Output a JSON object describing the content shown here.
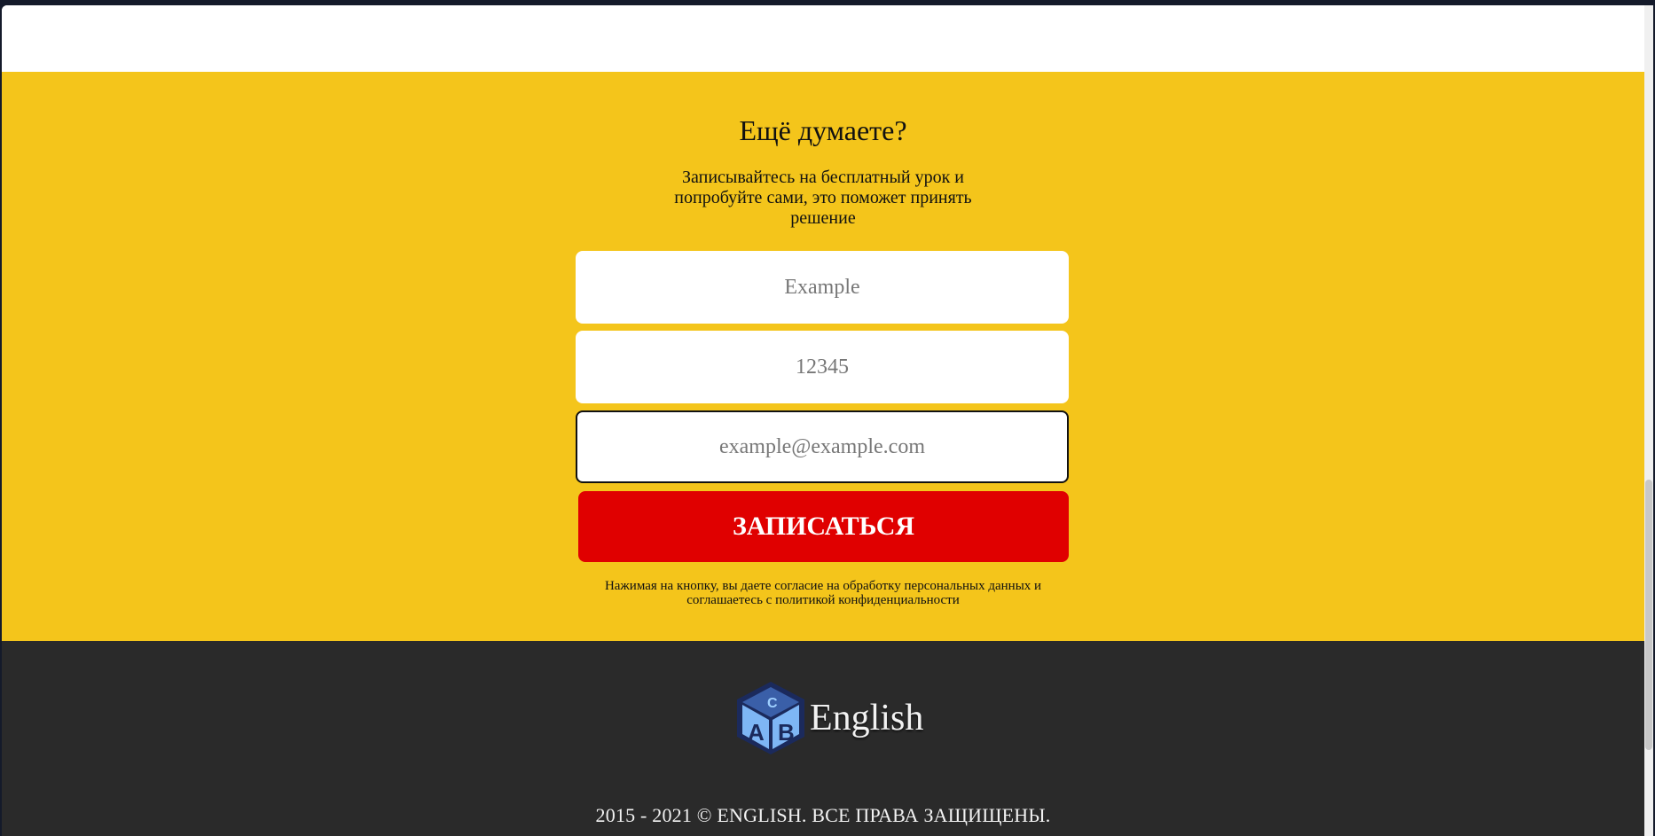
{
  "cta": {
    "title": "Ещё думаете?",
    "subtitle": "Записывайтесь на бесплатный урок и попробуйте сами, это поможет принять решение",
    "fields": {
      "name_placeholder": "Example",
      "phone_placeholder": "12345",
      "email_placeholder": "example@example.com"
    },
    "submit_label": "ЗАПИСАТЬСЯ",
    "consent_text": "Нажимая на кнопку, вы даете согласие на обработку персональных данных и соглашаетесь с политикой конфиденциальности"
  },
  "footer": {
    "logo_icon": "abc-cube-icon",
    "logo_text": "English",
    "copyright": "2015 - 2021 © ENGLISH. ВСЕ ПРАВА ЗАЩИЩЕНЫ."
  },
  "colors": {
    "cta_background": "#f4c51b",
    "button": "#e00000",
    "footer_background": "#2a2a2a",
    "logo_blue": "#7eb6f5",
    "logo_dark": "#1b2a5c"
  }
}
